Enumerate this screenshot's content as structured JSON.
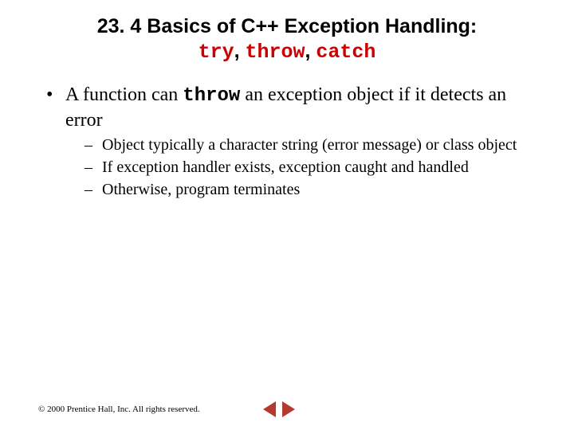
{
  "title": {
    "prefix": "23. 4  Basics of C++ Exception Handling: ",
    "code1": "try",
    "sep1": ", ",
    "code2": "throw",
    "sep2": ", ",
    "code3": "catch"
  },
  "bullets": {
    "l1": {
      "pre": "A function can ",
      "kw": "throw",
      "post": " an exception object if it detects an error"
    },
    "l2a": "Object typically a character string (error message) or class object",
    "l2b": "If exception handler exists, exception caught and handled",
    "l2c": "Otherwise, program terminates"
  },
  "footer": "© 2000 Prentice Hall, Inc. All rights reserved."
}
